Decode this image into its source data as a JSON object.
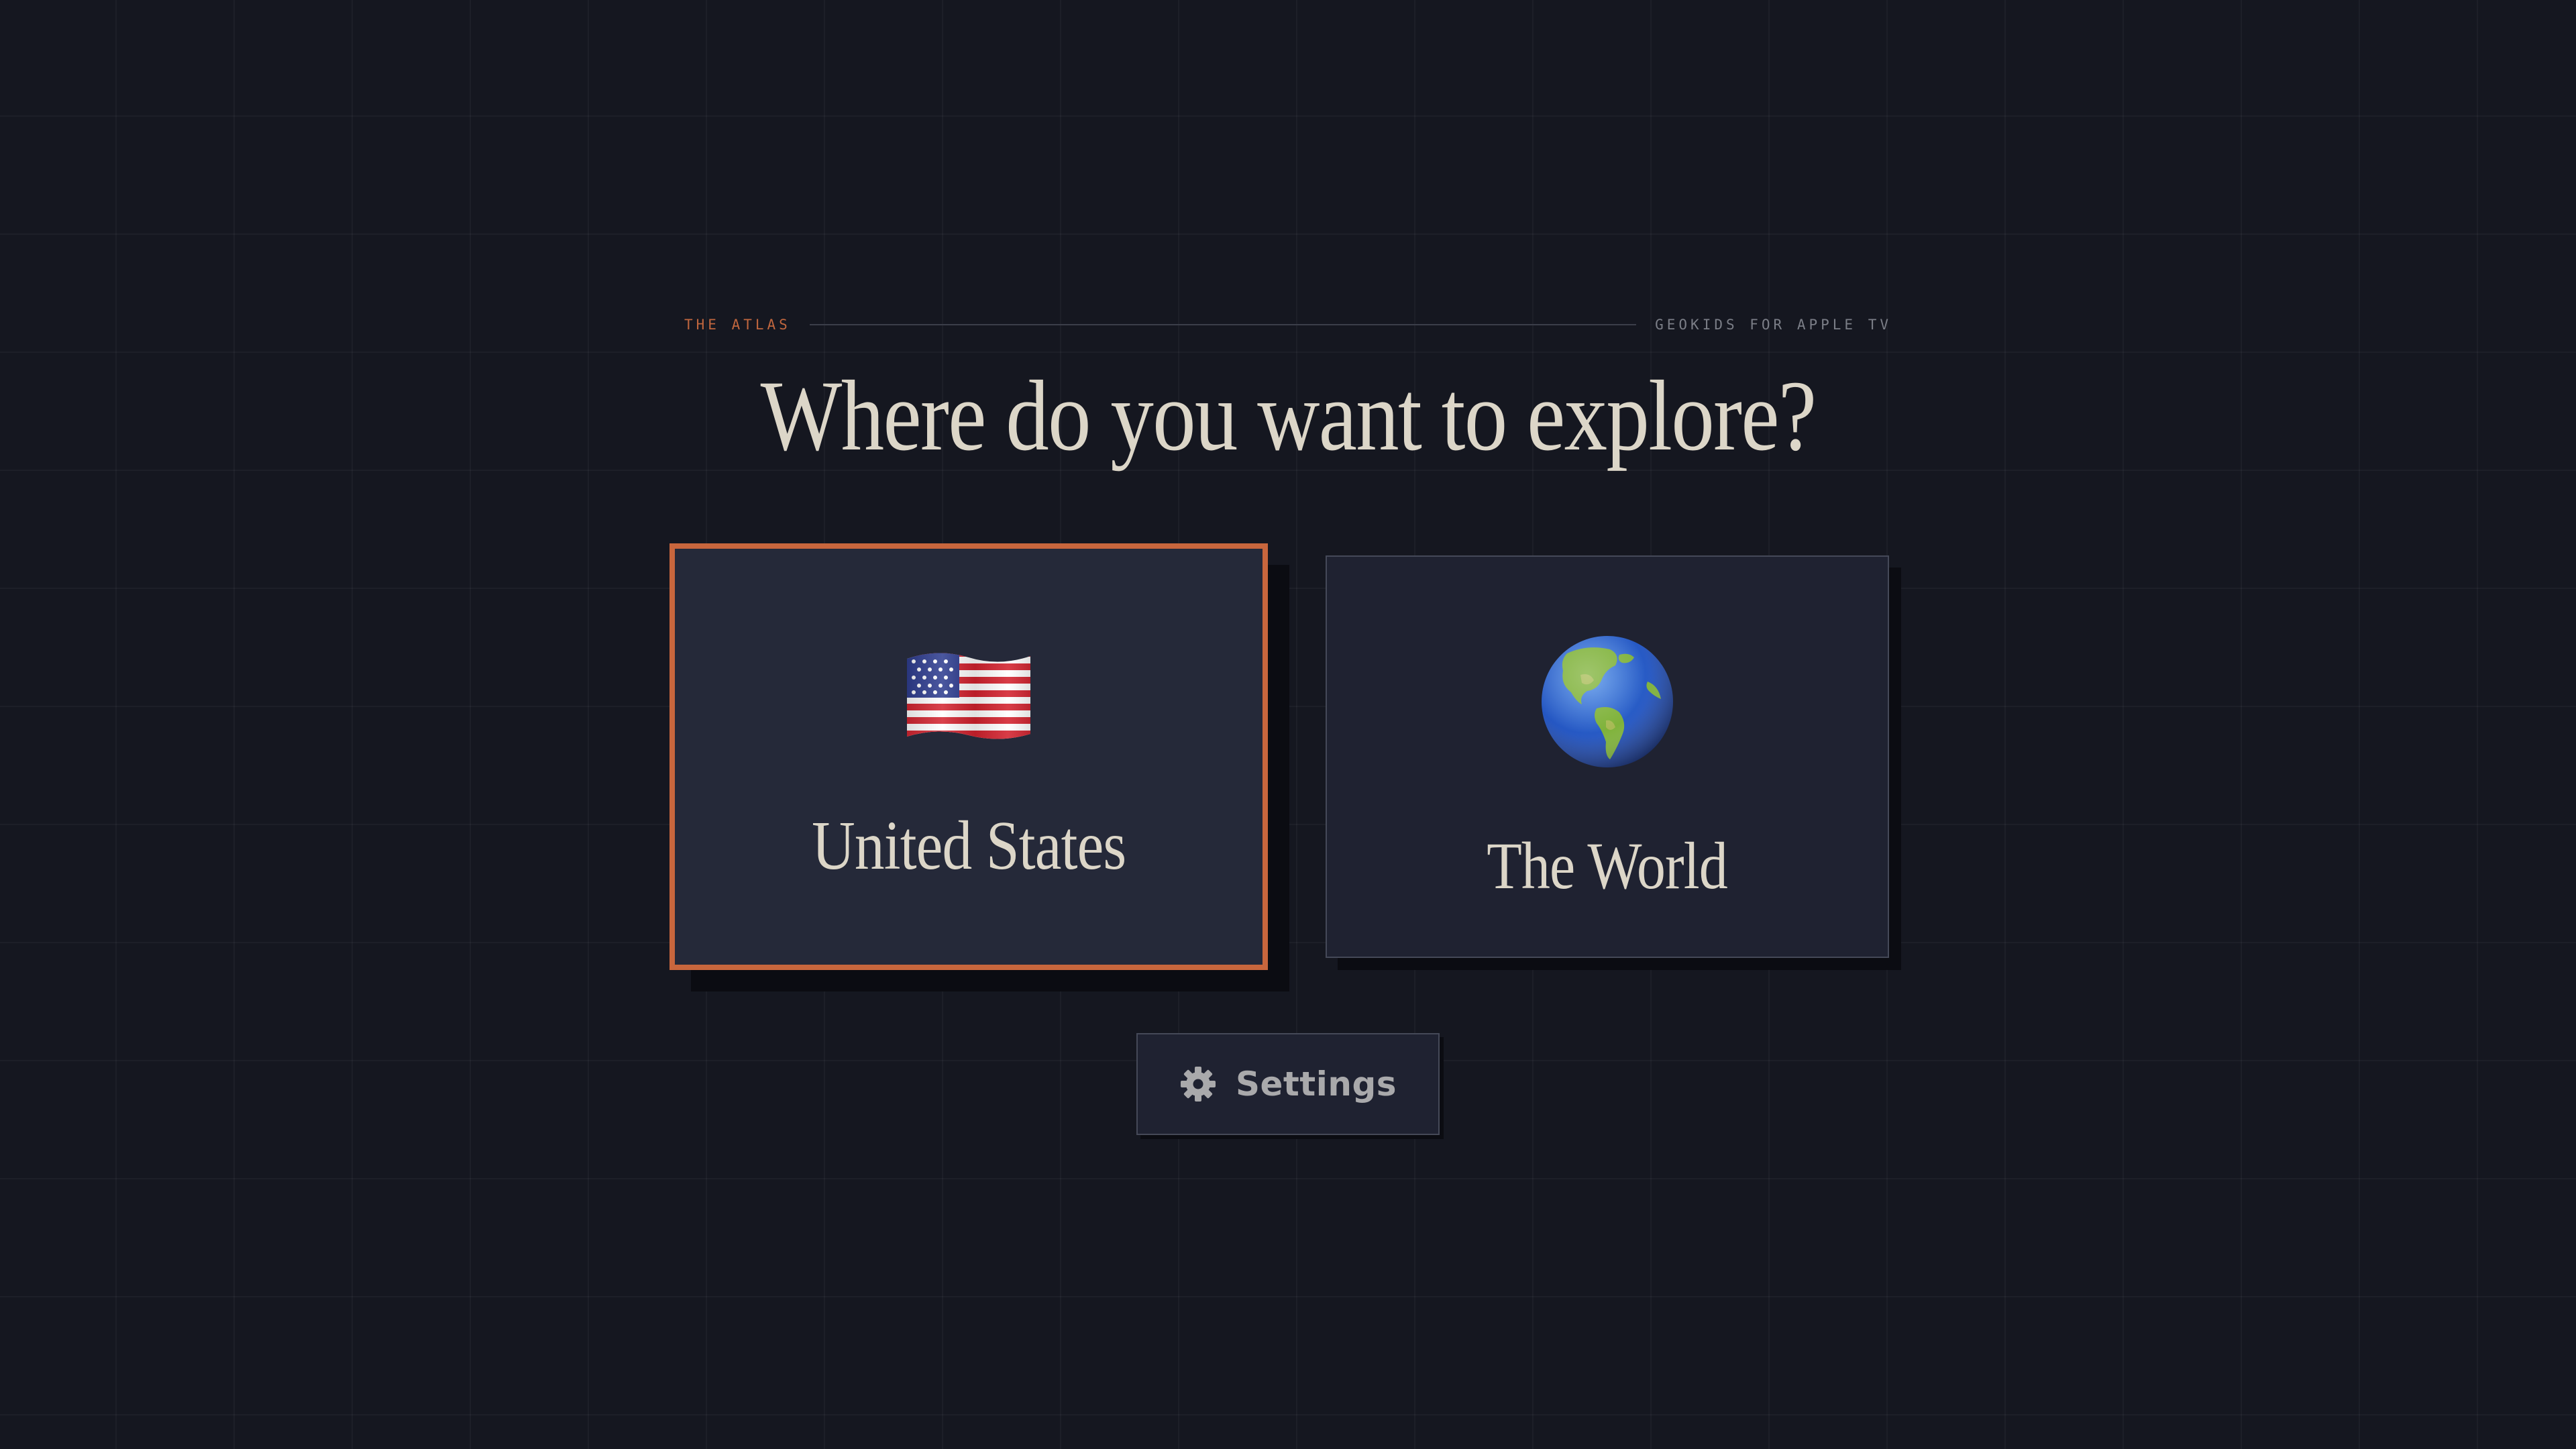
{
  "header": {
    "eyebrow_left": "THE ATLAS",
    "eyebrow_right": "GEOKIDS FOR APPLE TV",
    "title": "Where do you want to explore?"
  },
  "options": [
    {
      "label": "United States",
      "icon": "us-flag-icon",
      "focused": true
    },
    {
      "label": "The World",
      "icon": "globe-icon",
      "focused": false
    }
  ],
  "settings": {
    "label": "Settings",
    "icon": "gear-icon"
  },
  "colors": {
    "background": "#151720",
    "accent": "#c8663d",
    "title_text": "#dcd6c8",
    "card_focused_bg": "#252939",
    "card_bg": "#1f2231"
  }
}
